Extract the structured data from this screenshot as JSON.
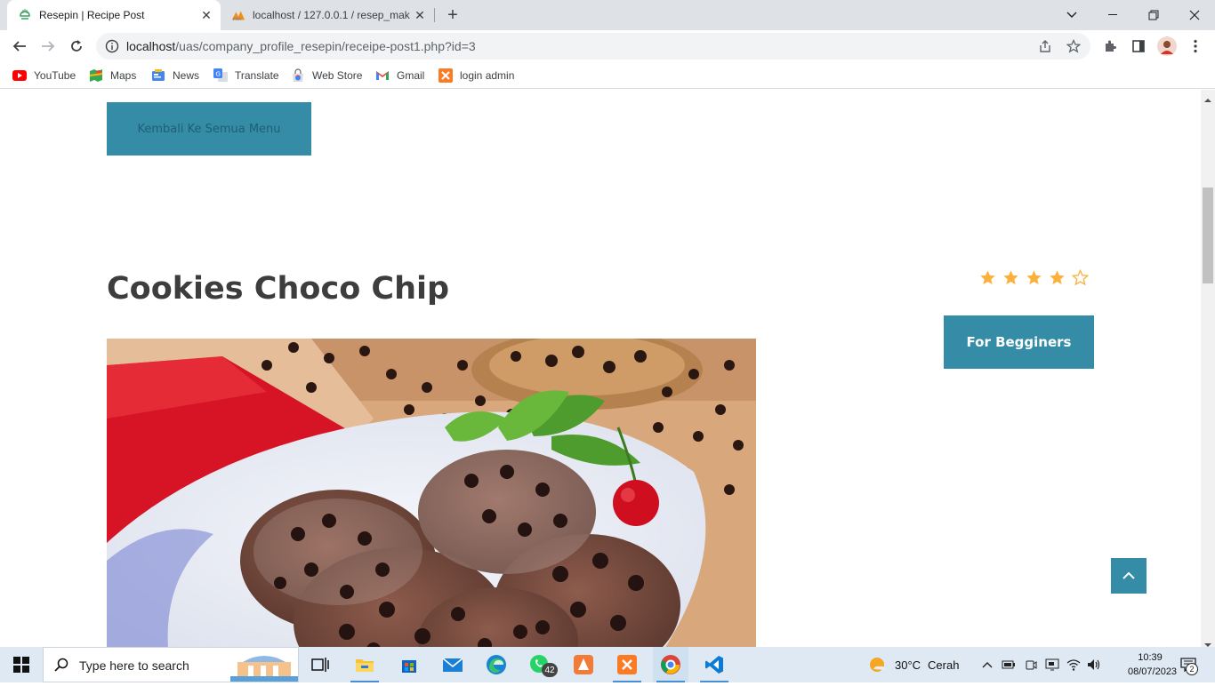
{
  "browser": {
    "tabs": [
      {
        "title": "Resepin | Recipe Post",
        "active": true
      },
      {
        "title": "localhost / 127.0.0.1 / resep_mak",
        "active": false
      }
    ],
    "new_tab": "+",
    "window": {
      "minimize": "—",
      "maximize": "❐",
      "close": "✕"
    },
    "url_host": "localhost",
    "url_path": "/uas/company_profile_resepin/receipe-post1.php?id=3",
    "bookmarks": [
      {
        "label": "YouTube",
        "icon": "youtube-icon"
      },
      {
        "label": "Maps",
        "icon": "maps-icon"
      },
      {
        "label": "News",
        "icon": "news-icon"
      },
      {
        "label": "Translate",
        "icon": "translate-icon"
      },
      {
        "label": "Web Store",
        "icon": "webstore-icon"
      },
      {
        "label": "Gmail",
        "icon": "gmail-icon"
      },
      {
        "label": "login admin",
        "icon": "xampp-icon"
      }
    ]
  },
  "page": {
    "back_button": "Kembali Ke Semua Menu",
    "title": "Cookies Choco Chip",
    "rating": 4,
    "rating_max": 5,
    "level": "For Begginers",
    "accent_color": "#348ca7"
  },
  "taskbar": {
    "search_placeholder": "Type here to search",
    "whatsapp_badge": "42",
    "weather_temp": "30°C",
    "weather_text": "Cerah",
    "time": "10:39",
    "date": "08/07/2023",
    "notifications": "2"
  }
}
